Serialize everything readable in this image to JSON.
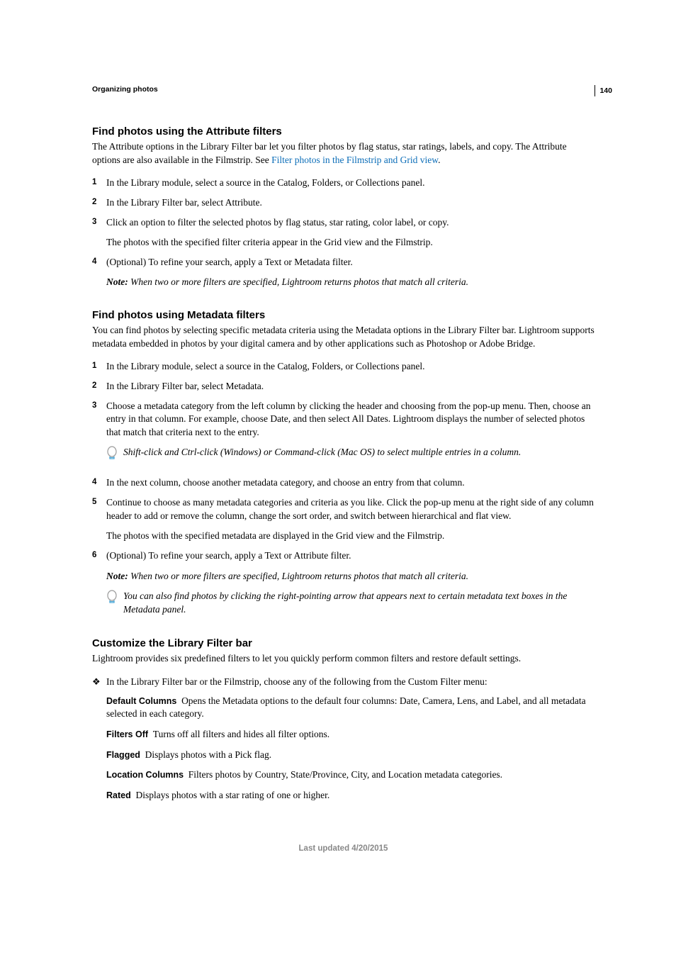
{
  "page_number": "140",
  "running_head": "Organizing photos",
  "footer": "Last updated 4/20/2015",
  "sections": {
    "attr": {
      "heading": "Find photos using the Attribute filters",
      "intro_pre": "The Attribute options in the Library Filter bar let you filter photos by flag status, star ratings, labels, and copy. The Attribute options are also available in the Filmstrip. See ",
      "intro_link": "Filter photos in the Filmstrip and Grid view",
      "intro_post": ".",
      "steps": [
        "In the Library module, select a source in the Catalog, Folders, or Collections panel.",
        "In the Library Filter bar, select Attribute.",
        "Click an option to filter the selected photos by flag status, star rating, color label, or copy.",
        "(Optional) To refine your search, apply a Text or Metadata filter."
      ],
      "step3_follow": "The photos with the specified filter criteria appear in the Grid view and the Filmstrip.",
      "note_label": "Note: ",
      "note": "When two or more filters are specified, Lightroom returns photos that match all criteria."
    },
    "meta": {
      "heading": "Find photos using Metadata filters",
      "intro": "You can find photos by selecting specific metadata criteria using the Metadata options in the Library Filter bar. Lightroom supports metadata embedded in photos by your digital camera and by other applications such as Photoshop or Adobe Bridge.",
      "steps": {
        "1": "In the Library module, select a source in the Catalog, Folders, or Collections panel.",
        "2": "In the Library Filter bar, select Metadata.",
        "3": "Choose a metadata category from the left column by clicking the header and choosing from the pop-up menu. Then, choose an entry in that column. For example, choose Date, and then select All Dates. Lightroom displays the number of selected photos that match that criteria next to the entry.",
        "3_tip": "Shift-click and Ctrl-click (Windows) or Command-click (Mac OS) to select multiple entries in a column.",
        "4": "In the next column, choose another metadata category, and choose an entry from that column.",
        "5": "Continue to choose as many metadata categories and criteria as you like. Click the pop-up menu at the right side of any column header to add or remove the column, change the sort order, and switch between hierarchical and flat view.",
        "5_follow": "The photos with the specified metadata are displayed in the Grid view and the Filmstrip.",
        "6": "(Optional) To refine your search, apply a Text or Attribute filter."
      },
      "note_label": "Note: ",
      "note": "When two or more filters are specified, Lightroom returns photos that match all criteria.",
      "end_tip": "You can also find photos by clicking the right-pointing arrow that appears next to certain metadata text boxes in the Metadata panel."
    },
    "customize": {
      "heading": "Customize the Library Filter bar",
      "intro": "Lightroom provides six predefined filters to let you quickly perform common filters and restore default settings.",
      "bullet": "In the Library Filter bar or the Filmstrip, choose any of the following from the Custom Filter menu:",
      "defs": [
        {
          "term": "Default Columns",
          "desc": "Opens the Metadata options to the default four columns: Date, Camera, Lens, and Label, and all metadata selected in each category."
        },
        {
          "term": "Filters Off",
          "desc": "Turns off all filters and hides all filter options."
        },
        {
          "term": "Flagged",
          "desc": "Displays photos with a Pick flag."
        },
        {
          "term": "Location Columns",
          "desc": "Filters photos by Country, State/Province, City, and Location metadata categories."
        },
        {
          "term": "Rated",
          "desc": "Displays photos with a star rating of one or higher."
        }
      ]
    }
  }
}
